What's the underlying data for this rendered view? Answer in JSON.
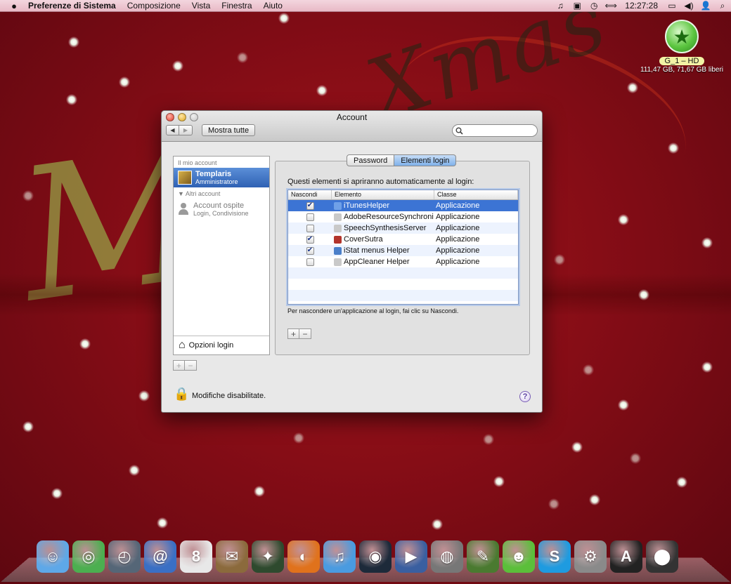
{
  "menubar": {
    "app_name": "Preferenze di Sistema",
    "items": [
      "Composizione",
      "Vista",
      "Finestra",
      "Aiuto"
    ],
    "clock": "12:27:28",
    "extras": [
      "♫",
      "▣",
      "◷",
      "⟺",
      "▭",
      "◀)",
      "👤",
      "⌕"
    ]
  },
  "desktop": {
    "disk_name": "G_1 – HD",
    "disk_info": "111,47 GB, 71,67 GB liberi",
    "wallpaper_text": "Xmas",
    "wallpaper_letter": "M"
  },
  "window": {
    "title": "Account",
    "show_all": "Mostra tutte",
    "search_placeholder": "",
    "sidebar": {
      "my_account_label": "Il mio account",
      "user_name": "Templaris",
      "user_role": "Amministratore",
      "other_accounts_label": "▼ Altri account",
      "guest_name": "Account ospite",
      "guest_sub": "Login, Condivisione",
      "login_options": "Opzioni login"
    },
    "tabs": [
      {
        "label": "Password",
        "active": false
      },
      {
        "label": "Elementi login",
        "active": true
      }
    ],
    "panel_heading": "Questi elementi si apriranno automaticamente al login:",
    "table": {
      "columns": [
        "Nascondi",
        "Elemento",
        "Classe"
      ],
      "rows": [
        {
          "hide": true,
          "name": "iTunesHelper",
          "class": "Applicazione",
          "icon_color": "#6fa0e8"
        },
        {
          "hide": false,
          "name": "AdobeResourceSynchroni",
          "class": "Applicazione",
          "icon_color": "#c9c9c9"
        },
        {
          "hide": false,
          "name": "SpeechSynthesisServer",
          "class": "Applicazione",
          "icon_color": "#c9c9c9"
        },
        {
          "hide": true,
          "name": "CoverSutra",
          "class": "Applicazione",
          "icon_color": "#b3342b"
        },
        {
          "hide": true,
          "name": "iStat menus Helper",
          "class": "Applicazione",
          "icon_color": "#4a7fc9"
        },
        {
          "hide": false,
          "name": "AppCleaner Helper",
          "class": "Applicazione",
          "icon_color": "#c9c9c9"
        }
      ]
    },
    "hint": "Per nascondere un'applicazione al login, fai clic su Nascondi.",
    "add_label": "+",
    "remove_label": "−",
    "lock_text": "Modifiche disabilitate.",
    "help_label": "?"
  },
  "dock": [
    {
      "name": "finder",
      "glyph": "☺",
      "color": "#5ea8e8"
    },
    {
      "name": "dashboard",
      "glyph": "◎",
      "color": "#4caf50"
    },
    {
      "name": "time-machine",
      "glyph": "◴",
      "color": "#556677"
    },
    {
      "name": "address-book",
      "glyph": "@",
      "color": "#3a6fc4"
    },
    {
      "name": "ical",
      "glyph": "8",
      "color": "#e8e8e8"
    },
    {
      "name": "stamp",
      "glyph": "✉",
      "color": "#8b6a3c"
    },
    {
      "name": "radar",
      "glyph": "✦",
      "color": "#2e4a2e"
    },
    {
      "name": "firefox",
      "glyph": "◐",
      "color": "#e0721c"
    },
    {
      "name": "itunes",
      "glyph": "♫",
      "color": "#4a9be0"
    },
    {
      "name": "camera",
      "glyph": "◉",
      "color": "#1d2a3a"
    },
    {
      "name": "imovie",
      "glyph": "▶",
      "color": "#3a5fa0"
    },
    {
      "name": "dvd",
      "glyph": "◍",
      "color": "#777777"
    },
    {
      "name": "feather",
      "glyph": "✎",
      "color": "#4a7a30"
    },
    {
      "name": "messenger",
      "glyph": "☻",
      "color": "#5bbf3a"
    },
    {
      "name": "skype",
      "glyph": "S",
      "color": "#1e9be0"
    },
    {
      "name": "system-preferences",
      "glyph": "⚙",
      "color": "#8a8a8a"
    },
    {
      "name": "applications-folder",
      "glyph": "A",
      "color": "#222222"
    },
    {
      "name": "cauldron",
      "glyph": "⬤",
      "color": "#333333"
    }
  ]
}
